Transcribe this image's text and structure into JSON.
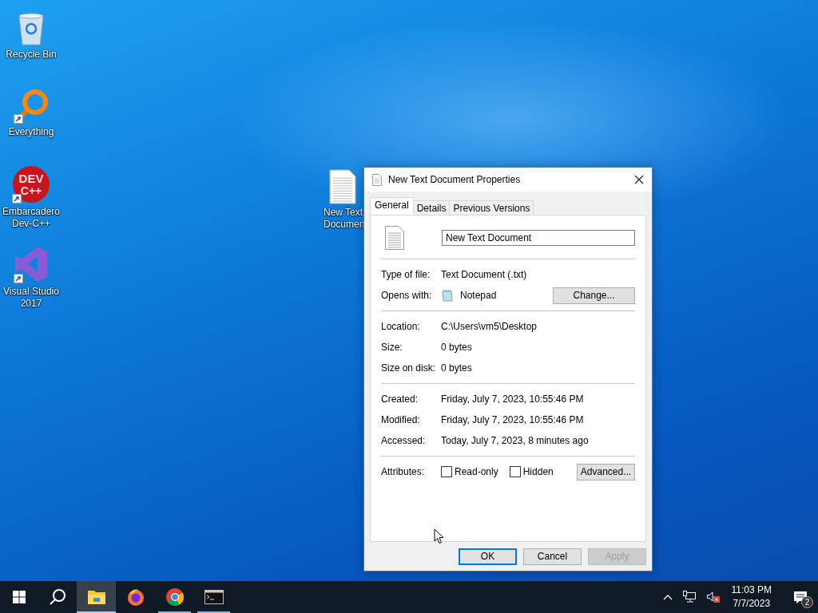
{
  "desktop_icons": [
    {
      "kind": "recycle",
      "label": "Recycle Bin",
      "shortcut": false
    },
    {
      "kind": "everything",
      "label": "Everything",
      "shortcut": true
    },
    {
      "kind": "devcpp",
      "label": "Embarcadero Dev-C++",
      "logo_text": [
        "DEV",
        "C++"
      ],
      "shortcut": true
    },
    {
      "kind": "vs",
      "label": "Visual Studio 2017",
      "shortcut": true
    },
    {
      "kind": "textfile",
      "label": "New Text Documen",
      "shortcut": false
    }
  ],
  "dialog": {
    "title": "New Text Document Properties",
    "tabs": [
      {
        "label": "General",
        "selected": true
      },
      {
        "label": "Details",
        "selected": false
      },
      {
        "label": "Previous Versions",
        "selected": false
      }
    ],
    "name_field": {
      "value": "New Text Document"
    },
    "sections": [
      [
        {
          "label": "Type of file:",
          "value": "Text Document (.txt)"
        },
        {
          "label": "Opens with:",
          "value": "Notepad",
          "kind": "app",
          "button": "Change..."
        }
      ],
      [
        {
          "label": "Location:",
          "value": "C:\\Users\\vm5\\Desktop"
        },
        {
          "label": "Size:",
          "value": "0 bytes"
        },
        {
          "label": "Size on disk:",
          "value": "0 bytes"
        }
      ],
      [
        {
          "label": "Created:",
          "value": "Friday, July 7, 2023, 10:55:46 PM"
        },
        {
          "label": "Modified:",
          "value": "Friday, July 7, 2023, 10:55:46 PM"
        },
        {
          "label": "Accessed:",
          "value": "Today, July 7, 2023, 8 minutes ago"
        }
      ]
    ],
    "attributes": {
      "label": "Attributes:",
      "checkboxes": [
        {
          "label": "Read-only",
          "checked": false
        },
        {
          "label": "Hidden",
          "checked": false
        }
      ],
      "button": "Advanced..."
    },
    "buttons": [
      {
        "label": "OK",
        "default": true,
        "disabled": false
      },
      {
        "label": "Cancel",
        "default": false,
        "disabled": false
      },
      {
        "label": "Apply",
        "default": false,
        "disabled": true
      }
    ]
  },
  "taskbar": {
    "apps": [
      {
        "kind": "explorer",
        "selected": true,
        "running": true
      },
      {
        "kind": "firefox",
        "selected": false,
        "running": false
      },
      {
        "kind": "chrome",
        "selected": false,
        "running": true
      },
      {
        "kind": "terminal",
        "selected": false,
        "running": true
      }
    ],
    "volume_muted": true,
    "clock": {
      "time": "11:03 PM",
      "date": "7/7/2023"
    },
    "notifications": {
      "count": "2"
    }
  }
}
